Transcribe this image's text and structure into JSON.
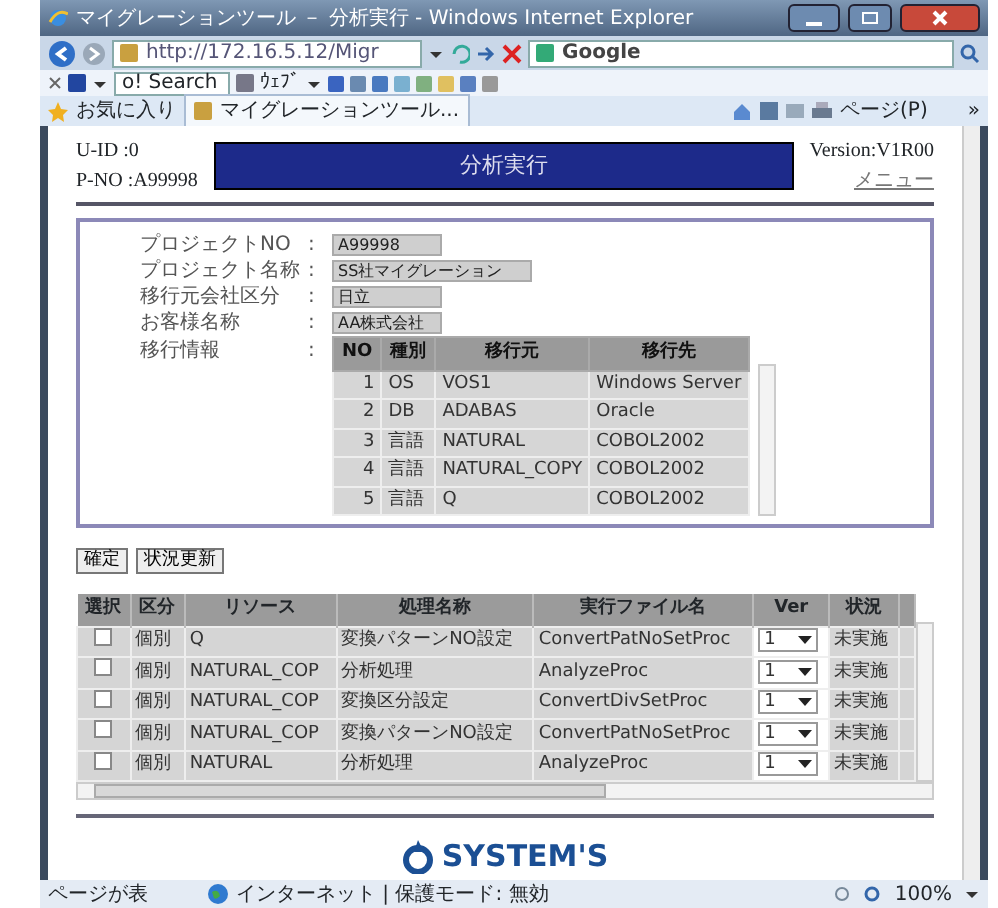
{
  "window": {
    "title": "マイグレーションツール － 分析実行 - Windows Internet Explorer"
  },
  "address_bar": {
    "url": "http://172.16.5.12/Migr",
    "search_engine": "Google"
  },
  "toolbar": {
    "search_field": "o! Search",
    "web_button": "ｳｪﾌﾞ"
  },
  "favorites_bar": {
    "favorites": "お気に入り",
    "tab": "マイグレーションツール...",
    "page_menu": "ページ(P)",
    "more": "»"
  },
  "page": {
    "user_id": "U-ID :0",
    "project_no_label": "P-NO :A99998",
    "heading": "分析実行",
    "version": "Version:V1R00",
    "menu_link": "メニュー",
    "fields": [
      {
        "label": "プロジェクトNO",
        "separator": ":",
        "value": "A99998"
      },
      {
        "label": "プロジェクト名称",
        "separator": ":",
        "value": "SS社マイグレーション"
      },
      {
        "label": "移行元会社区分",
        "separator": ":",
        "value": "日立"
      },
      {
        "label": "お客様名称",
        "separator": ":",
        "value": "AA株式会社"
      }
    ],
    "migration": {
      "label": "移行情報",
      "separator": ":",
      "columns": [
        "NO",
        "種別",
        "移行元",
        "移行先"
      ],
      "rows": [
        [
          "1",
          "OS",
          "VOS1",
          "Windows Server"
        ],
        [
          "2",
          "DB",
          "ADABAS",
          "Oracle"
        ],
        [
          "3",
          "言語",
          "NATURAL",
          "COBOL2002"
        ],
        [
          "4",
          "言語",
          "NATURAL_COPY",
          "COBOL2002"
        ],
        [
          "5",
          "言語",
          "Q",
          "COBOL2002"
        ]
      ]
    },
    "buttons": [
      "確定",
      "状況更新"
    ],
    "process_table": {
      "columns": [
        "選択",
        "区分",
        "リソース",
        "処理名称",
        "実行ファイル名",
        "Ver",
        "状況"
      ],
      "rows": [
        {
          "checked": false,
          "kubun": "個別",
          "resource": "Q",
          "process": "変換パターンNO設定",
          "file": "ConvertPatNoSetProc",
          "ver": "1",
          "status": "未実施"
        },
        {
          "checked": false,
          "kubun": "個別",
          "resource": "NATURAL_COP",
          "process": "分析処理",
          "file": "AnalyzeProc",
          "ver": "1",
          "status": "未実施"
        },
        {
          "checked": false,
          "kubun": "個別",
          "resource": "NATURAL_COP",
          "process": "変換区分設定",
          "file": "ConvertDivSetProc",
          "ver": "1",
          "status": "未実施"
        },
        {
          "checked": false,
          "kubun": "個別",
          "resource": "NATURAL_COP",
          "process": "変換パターンNO設定",
          "file": "ConvertPatNoSetProc",
          "ver": "1",
          "status": "未実施"
        },
        {
          "checked": false,
          "kubun": "個別",
          "resource": "NATURAL",
          "process": "分析処理",
          "file": "AnalyzeProc",
          "ver": "1",
          "status": "未実施"
        }
      ]
    },
    "logo": "SYSTEM'S"
  },
  "status_bar": {
    "message": "ページが表",
    "zone": "インターネット | 保護モード: 無効",
    "zoom": "100%"
  }
}
